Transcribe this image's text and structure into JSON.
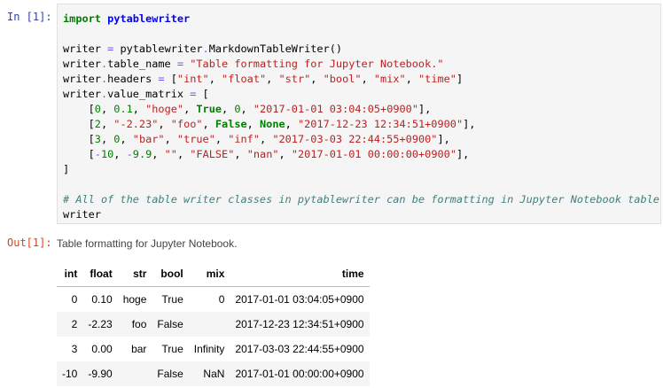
{
  "input_prompt": "In [1]:",
  "output_prompt": "Out[1]:",
  "code_lines": [
    [
      [
        "import",
        "k"
      ],
      [
        " ",
        "p"
      ],
      [
        "pytablewriter",
        "nn"
      ]
    ],
    [],
    [
      [
        "writer ",
        "p"
      ],
      [
        "=",
        "o"
      ],
      [
        " pytablewriter",
        "p"
      ],
      [
        ".",
        "o"
      ],
      [
        "MarkdownTableWriter()",
        "p"
      ]
    ],
    [
      [
        "writer",
        "p"
      ],
      [
        ".",
        "o"
      ],
      [
        "table_name ",
        "p"
      ],
      [
        "=",
        "o"
      ],
      [
        " ",
        "p"
      ],
      [
        "\"Table formatting for Jupyter Notebook.\"",
        "s"
      ]
    ],
    [
      [
        "writer",
        "p"
      ],
      [
        ".",
        "o"
      ],
      [
        "headers ",
        "p"
      ],
      [
        "=",
        "o"
      ],
      [
        " [",
        "p"
      ],
      [
        "\"int\"",
        "s"
      ],
      [
        ", ",
        "p"
      ],
      [
        "\"float\"",
        "s"
      ],
      [
        ", ",
        "p"
      ],
      [
        "\"str\"",
        "s"
      ],
      [
        ", ",
        "p"
      ],
      [
        "\"bool\"",
        "s"
      ],
      [
        ", ",
        "p"
      ],
      [
        "\"mix\"",
        "s"
      ],
      [
        ", ",
        "p"
      ],
      [
        "\"time\"",
        "s"
      ],
      [
        "]",
        "p"
      ]
    ],
    [
      [
        "writer",
        "p"
      ],
      [
        ".",
        "o"
      ],
      [
        "value_matrix ",
        "p"
      ],
      [
        "=",
        "o"
      ],
      [
        " [",
        "p"
      ]
    ],
    [
      [
        "    [",
        "p"
      ],
      [
        "0",
        "m"
      ],
      [
        ", ",
        "p"
      ],
      [
        "0.1",
        "m"
      ],
      [
        ", ",
        "p"
      ],
      [
        "\"hoge\"",
        "s"
      ],
      [
        ", ",
        "p"
      ],
      [
        "True",
        "k"
      ],
      [
        ", ",
        "p"
      ],
      [
        "0",
        "m"
      ],
      [
        ", ",
        "p"
      ],
      [
        "\"2017-01-01 03:04:05+0900\"",
        "s"
      ],
      [
        "],",
        "p"
      ]
    ],
    [
      [
        "    [",
        "p"
      ],
      [
        "2",
        "m"
      ],
      [
        ", ",
        "p"
      ],
      [
        "\"-2.23\"",
        "s"
      ],
      [
        ", ",
        "p"
      ],
      [
        "\"foo\"",
        "s"
      ],
      [
        ", ",
        "p"
      ],
      [
        "False",
        "k"
      ],
      [
        ", ",
        "p"
      ],
      [
        "None",
        "k"
      ],
      [
        ", ",
        "p"
      ],
      [
        "\"2017-12-23 12:34:51+0900\"",
        "s"
      ],
      [
        "],",
        "p"
      ]
    ],
    [
      [
        "    [",
        "p"
      ],
      [
        "3",
        "m"
      ],
      [
        ", ",
        "p"
      ],
      [
        "0",
        "m"
      ],
      [
        ", ",
        "p"
      ],
      [
        "\"bar\"",
        "s"
      ],
      [
        ", ",
        "p"
      ],
      [
        "\"true\"",
        "s"
      ],
      [
        ", ",
        "p"
      ],
      [
        "\"inf\"",
        "s"
      ],
      [
        ", ",
        "p"
      ],
      [
        "\"2017-03-03 22:44:55+0900\"",
        "s"
      ],
      [
        "],",
        "p"
      ]
    ],
    [
      [
        "    [",
        "p"
      ],
      [
        "-",
        "o"
      ],
      [
        "10",
        "m"
      ],
      [
        ", ",
        "p"
      ],
      [
        "-",
        "o"
      ],
      [
        "9.9",
        "m"
      ],
      [
        ", ",
        "p"
      ],
      [
        "\"\"",
        "s"
      ],
      [
        ", ",
        "p"
      ],
      [
        "\"FALSE\"",
        "s"
      ],
      [
        ", ",
        "p"
      ],
      [
        "\"nan\"",
        "s"
      ],
      [
        ", ",
        "p"
      ],
      [
        "\"2017-01-01 00:00:00+0900\"",
        "s"
      ],
      [
        "],",
        "p"
      ]
    ],
    [
      [
        "]",
        "p"
      ]
    ],
    [],
    [
      [
        "# All of the table writer classes in pytablewriter can be formatting in Jupyter Notebook table.",
        "c"
      ]
    ],
    [
      [
        "writer",
        "p"
      ]
    ]
  ],
  "output": {
    "title": "Table formatting for Jupyter Notebook.",
    "headers": [
      "int",
      "float",
      "str",
      "bool",
      "mix",
      "time"
    ],
    "rows": [
      [
        "0",
        "0.10",
        "hoge",
        "True",
        "0",
        "2017-01-01 03:04:05+0900"
      ],
      [
        "2",
        "-2.23",
        "foo",
        "False",
        "",
        "2017-12-23 12:34:51+0900"
      ],
      [
        "3",
        "0.00",
        "bar",
        "True",
        "Infinity",
        "2017-03-03 22:44:55+0900"
      ],
      [
        "-10",
        "-9.90",
        "",
        "False",
        "NaN",
        "2017-01-01 00:00:00+0900"
      ]
    ]
  }
}
